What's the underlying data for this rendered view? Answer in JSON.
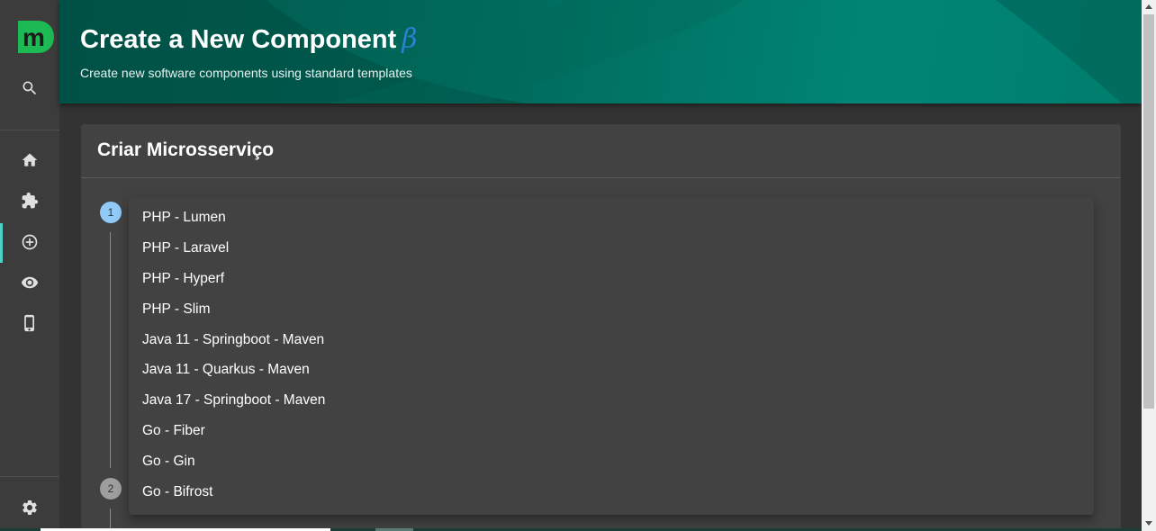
{
  "header": {
    "title": "Create a New Component",
    "beta": "β",
    "subtitle": "Create new software components using standard templates"
  },
  "sidebar": {
    "logo_letter": "m",
    "logo_color": "#1db954",
    "items": [
      {
        "icon": "search-icon"
      },
      {
        "icon": "home-icon"
      },
      {
        "icon": "puzzle-icon"
      },
      {
        "icon": "add-circle-icon",
        "active": true
      },
      {
        "icon": "eye-icon"
      },
      {
        "icon": "mobile-icon"
      },
      {
        "icon": "settings-icon"
      }
    ],
    "active_color": "#4fd1c5"
  },
  "card": {
    "title": "Criar Microsserviço"
  },
  "stepper": {
    "steps": [
      {
        "number": "1",
        "color": "#90caf9"
      },
      {
        "number": "2",
        "color": "#9e9e9e"
      }
    ]
  },
  "menu": {
    "options": [
      "PHP - Lumen",
      "PHP - Laravel",
      "PHP - Hyperf",
      "PHP - Slim",
      "Java 11 - Springboot - Maven",
      "Java 11 - Quarkus - Maven",
      "Java 17 - Springboot - Maven",
      "Go - Fiber",
      "Go - Gin",
      "Go - Bifrost"
    ]
  },
  "colors": {
    "header_gradient_start": "#00574a",
    "header_gradient_end": "#008575",
    "background": "#333333",
    "card": "#424242"
  }
}
